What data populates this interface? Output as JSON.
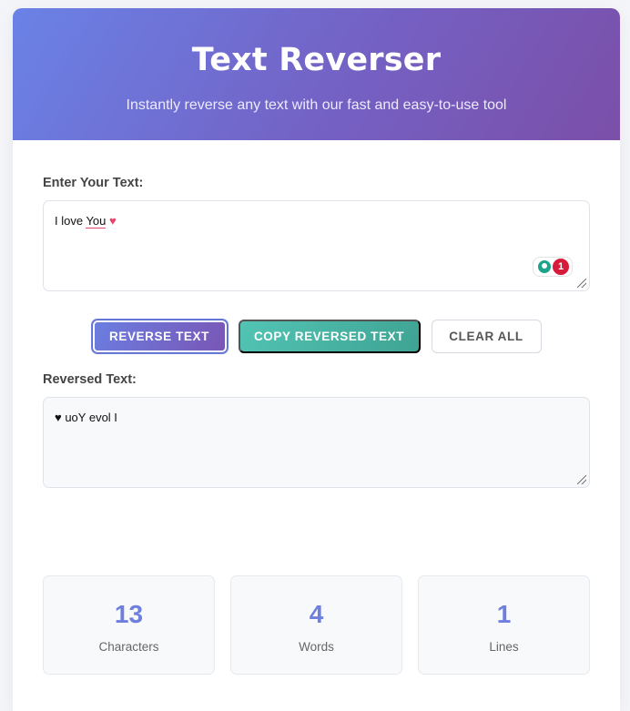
{
  "header": {
    "title": "Text Reverser",
    "subtitle": "Instantly reverse any text with our fast and easy-to-use tool"
  },
  "input": {
    "label": "Enter Your Text:",
    "text_plain": "I love ",
    "text_underlined": "You",
    "emoji": "♥",
    "grammar_issue_count": "1"
  },
  "buttons": {
    "reverse_label": "REVERSE TEXT",
    "copy_label": "COPY REVERSED TEXT",
    "clear_label": "CLEAR ALL"
  },
  "output": {
    "label": "Reversed Text:",
    "text": "♥ uoY evol I"
  },
  "stats": [
    {
      "value": "13",
      "label": "Characters"
    },
    {
      "value": "4",
      "label": "Words"
    },
    {
      "value": "1",
      "label": "Lines"
    }
  ],
  "colors": {
    "accent": "#6f7fdc",
    "gradient_start": "#6a82e6",
    "gradient_end": "#7b4fa8",
    "copy_button": "#4bb8a8"
  },
  "icons": {
    "grammar_badge": "lightbulb-icon",
    "resize": "resize-handle-icon"
  }
}
